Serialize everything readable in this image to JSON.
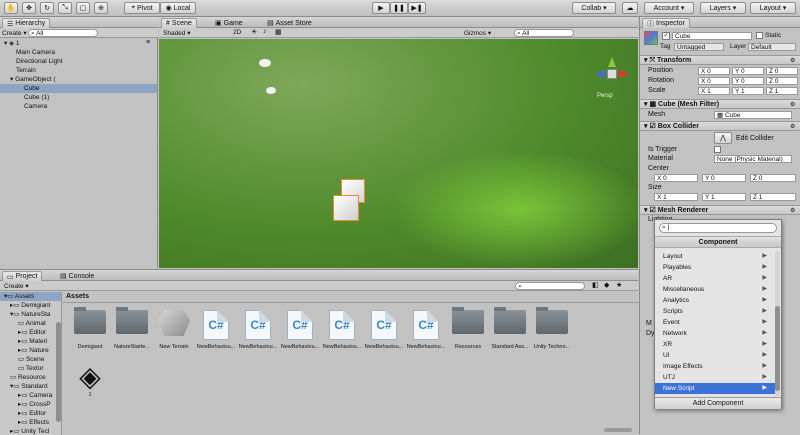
{
  "toolbar": {
    "pivot": "Pivot",
    "local": "Local",
    "collab": "Collab",
    "account": "Account",
    "layers": "Layers",
    "layout": "Layout"
  },
  "hierarchy": {
    "tab": "Hierarchy",
    "create": "Create",
    "scene": "1",
    "items": [
      "Main Camera",
      "Directional Light",
      "Terrain",
      "GameObject (",
      "Cube",
      "Cube (1)",
      "Camera"
    ]
  },
  "scene": {
    "tabs": [
      "Scene",
      "Game",
      "Asset Store"
    ],
    "shading": "Shaded",
    "mode_2d": "2D",
    "gizmos": "Gizmos",
    "search_placeholder": "All",
    "persp": "Persp"
  },
  "inspector": {
    "tab": "Inspector",
    "name": "Cube",
    "static": "Static",
    "tag_label": "Tag",
    "tag": "Untagged",
    "layer_label": "Layer",
    "layer": "Default",
    "transform": {
      "title": "Transform",
      "position": "Position",
      "rotation": "Rotation",
      "scale": "Scale",
      "pos": [
        "0",
        "0",
        "0"
      ],
      "rot": [
        "0",
        "0",
        "0"
      ],
      "scl": [
        "1",
        "1",
        "1"
      ]
    },
    "mesh_filter": {
      "title": "Cube (Mesh Filter)",
      "mesh_label": "Mesh",
      "mesh": "Cube"
    },
    "box_collider": {
      "title": "Box Collider",
      "edit": "Edit Collider",
      "is_trigger": "Is Trigger",
      "material_label": "Material",
      "material": "None (Physic Material)",
      "center": "Center",
      "center_vals": [
        "0",
        "0",
        "0"
      ],
      "size": "Size",
      "size_vals": [
        "1",
        "1",
        "1"
      ]
    },
    "mesh_renderer": {
      "title": "Mesh Renderer",
      "lighting": "Lighting"
    },
    "partial": [
      "M",
      "Dy"
    ],
    "add_component": "Add Component"
  },
  "component_menu": {
    "header": "Component",
    "items": [
      "Layout",
      "Playables",
      "AR",
      "Miscellaneous",
      "Analytics",
      "Scripts",
      "Event",
      "Network",
      "XR",
      "UI",
      "Image Effects",
      "UTJ",
      "New Script"
    ],
    "selected": "New Script"
  },
  "project": {
    "tabs": [
      "Project",
      "Console"
    ],
    "create": "Create",
    "breadcrumb": "Assets",
    "tree": [
      "Assets",
      "Demigiant",
      "NatureSta",
      "Animat",
      "Editor",
      "Materi",
      "Nature",
      "Scene",
      "Textur",
      "Resource",
      "Standard",
      "Camera",
      "CrossP",
      "Editor",
      "Effects",
      "Unity Tecl"
    ],
    "assets": [
      {
        "label": "Demigiant",
        "kind": "folder"
      },
      {
        "label": "NatureStarte...",
        "kind": "folder"
      },
      {
        "label": "New Terrain",
        "kind": "terrain"
      },
      {
        "label": "NewBehaviou...",
        "kind": "cs"
      },
      {
        "label": "NewBehaviou...",
        "kind": "cs"
      },
      {
        "label": "NewBehaviou...",
        "kind": "cs"
      },
      {
        "label": "NewBehaviou...",
        "kind": "cs"
      },
      {
        "label": "NewBehaviou...",
        "kind": "cs"
      },
      {
        "label": "NewBehaviou...",
        "kind": "cs"
      },
      {
        "label": "Resources",
        "kind": "folder"
      },
      {
        "label": "Standard Ass...",
        "kind": "folder"
      },
      {
        "label": "Unity Techno...",
        "kind": "folder"
      }
    ],
    "unity_asset": "1"
  },
  "colors": {
    "selection": "#3a72d8",
    "grass": "#4f8a2c"
  }
}
